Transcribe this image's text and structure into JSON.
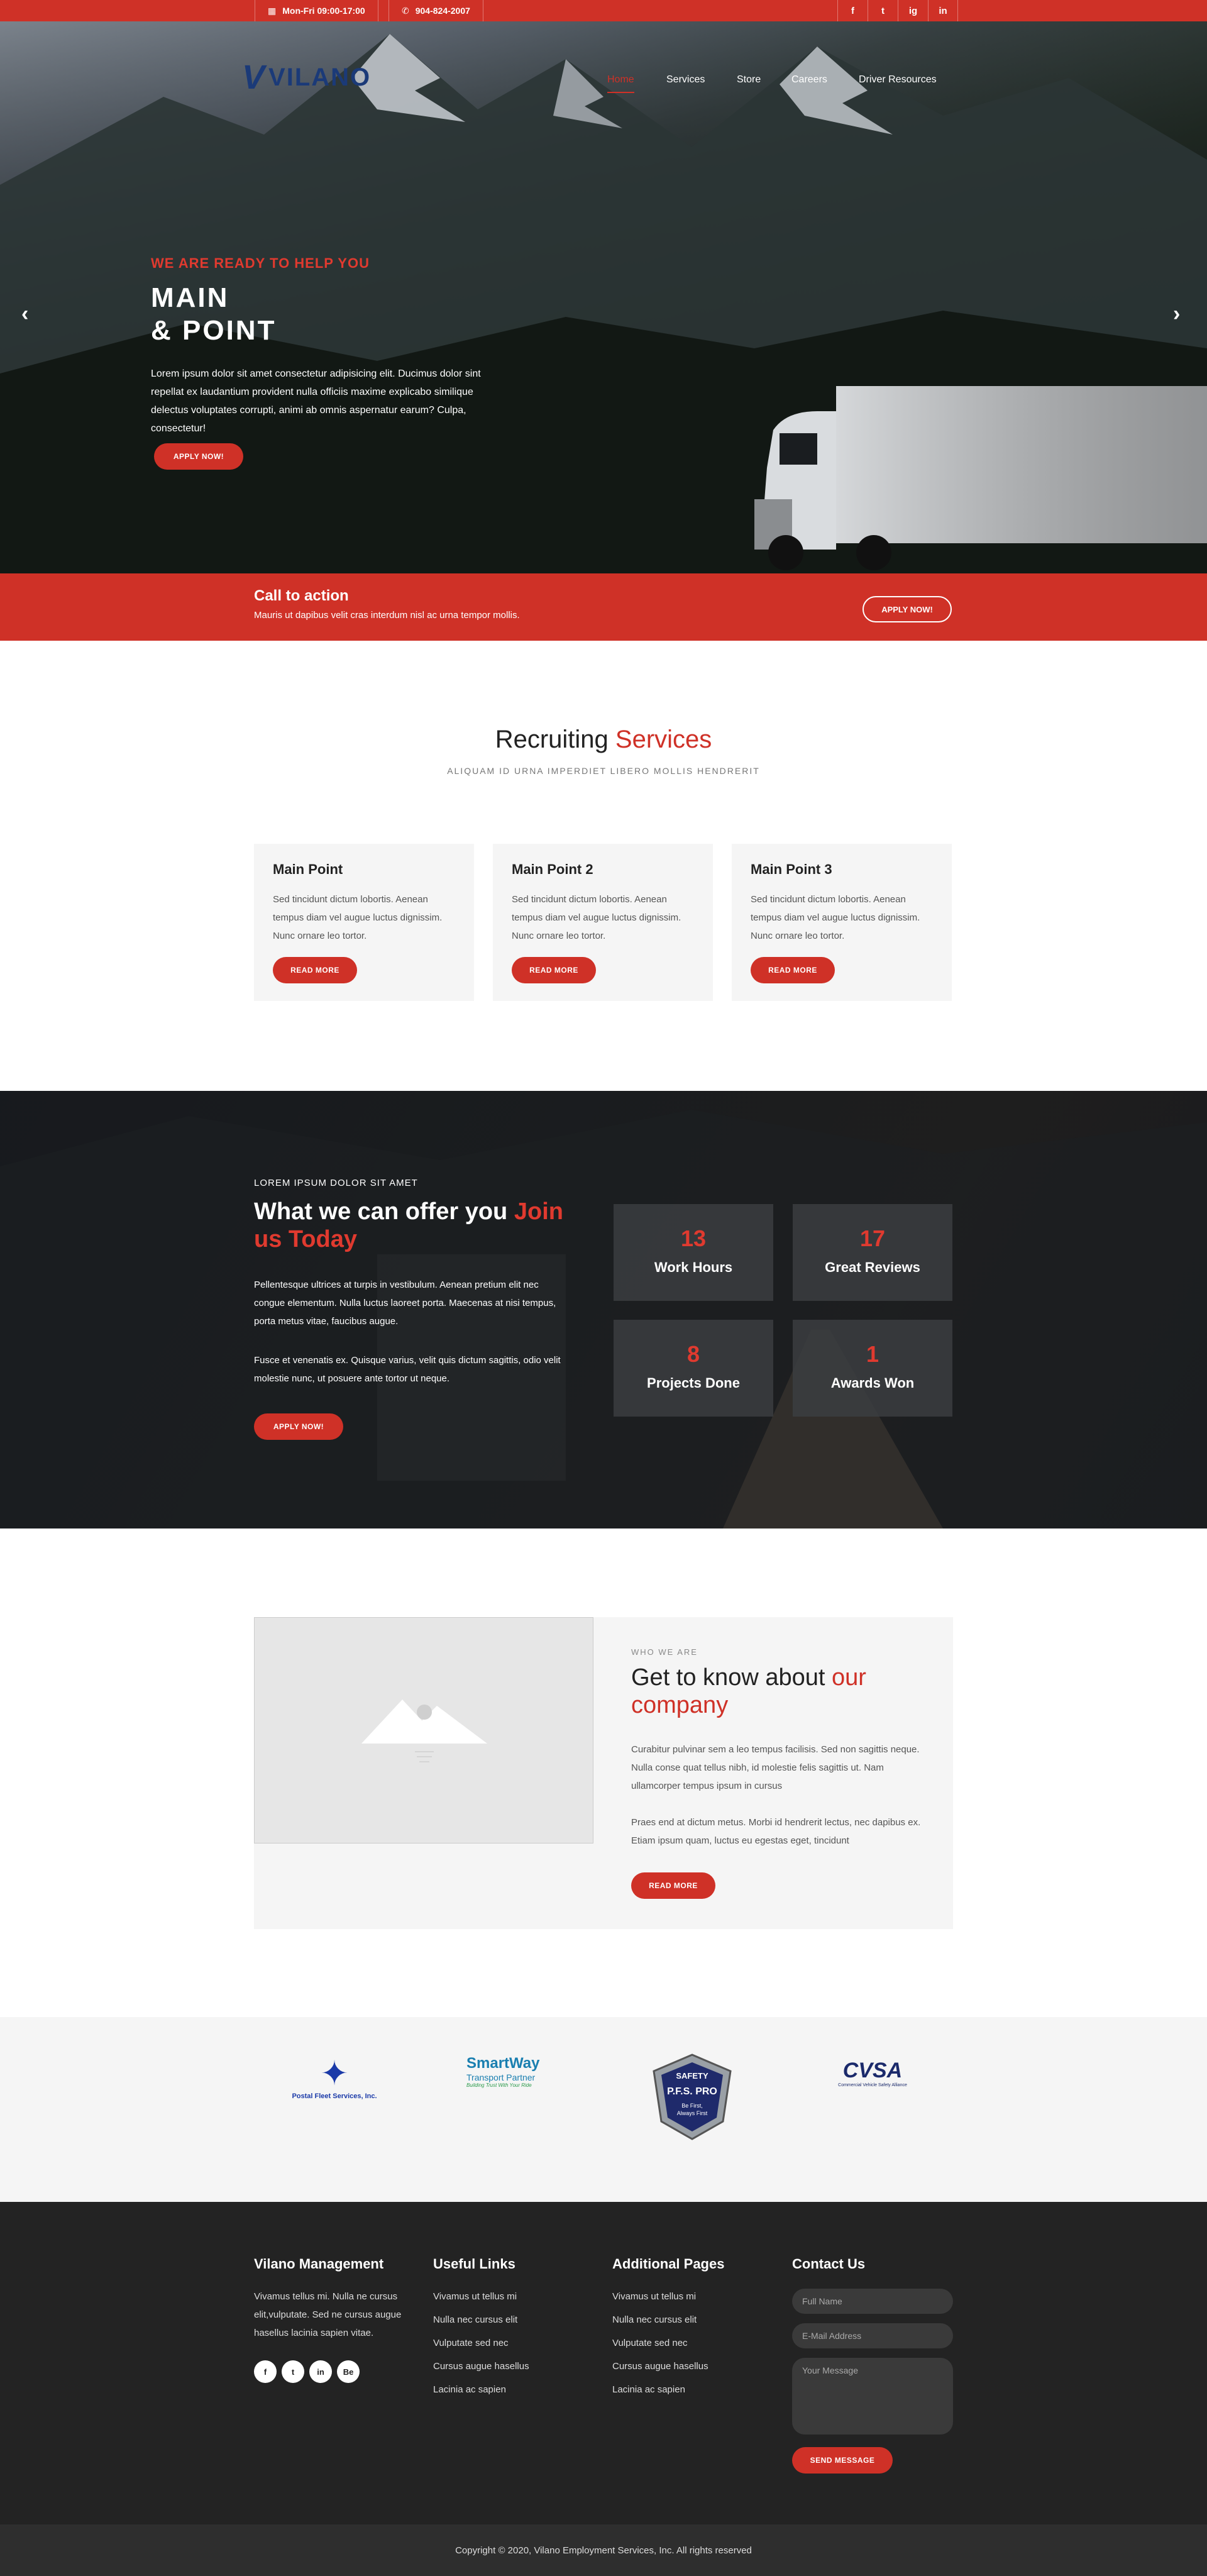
{
  "topbar": {
    "hours": "Mon-Fri 09:00-17:00",
    "phone": "904-824-2007",
    "social": [
      "f",
      "t",
      "ig",
      "in"
    ]
  },
  "header": {
    "logo_text": "VILANO",
    "nav": [
      "Home",
      "Services",
      "Store",
      "Careers",
      "Driver Resources"
    ],
    "active": "Home"
  },
  "hero": {
    "eyebrow": "WE ARE READY TO HELP YOU",
    "title_line1": "MAIN",
    "title_line2": "& POINT",
    "description": "Lorem ipsum dolor sit amet consectetur adipisicing elit. Ducimus dolor sint repellat ex laudantium provident nulla officiis maxime explicabo similique delectus voluptates corrupti, animi ab omnis aspernatur earum? Culpa, consectetur!",
    "button": "APPLY NOW!"
  },
  "cta": {
    "title": "Call to action",
    "text": "Mauris ut dapibus velit cras interdum nisl ac urna tempor mollis.",
    "button": "APPLY NOW!"
  },
  "services": {
    "title_plain": "Recruiting",
    "title_red": "Services",
    "subtitle": "ALIQUAM ID URNA IMPERDIET LIBERO MOLLIS HENDRERIT",
    "cards": [
      {
        "title": "Main Point",
        "text": "Sed tincidunt dictum lobortis. Aenean tempus diam vel augue luctus dignissim. Nunc ornare leo tortor.",
        "button": "READ MORE"
      },
      {
        "title": "Main Point 2",
        "text": "Sed tincidunt dictum lobortis. Aenean tempus diam vel augue luctus dignissim. Nunc ornare leo tortor.",
        "button": "READ MORE"
      },
      {
        "title": "Main Point 3",
        "text": "Sed tincidunt dictum lobortis. Aenean tempus diam vel augue luctus dignissim. Nunc ornare leo tortor.",
        "button": "READ MORE"
      }
    ]
  },
  "offer": {
    "eyebrow": "LOREM IPSUM DOLOR SIT AMET",
    "title_plain": "What we can offer you",
    "title_red": "Join us Today",
    "p1": "Pellentesque ultrices at turpis in vestibulum. Aenean pretium elit nec congue elementum. Nulla luctus laoreet porta. Maecenas at nisi tempus, porta metus vitae, faucibus augue.",
    "p2": "Fusce et venenatis ex. Quisque varius, velit quis dictum sagittis, odio velit molestie nunc, ut posuere ante tortor ut neque.",
    "button": "APPLY NOW!",
    "stats": [
      {
        "num": "13",
        "label": "Work Hours"
      },
      {
        "num": "17",
        "label": "Great Reviews"
      },
      {
        "num": "8",
        "label": "Projects Done"
      },
      {
        "num": "1",
        "label": "Awards Won"
      }
    ]
  },
  "about": {
    "eyebrow": "WHO WE ARE",
    "title_plain": "Get to know about",
    "title_red": "our company",
    "p1": "Curabitur pulvinar sem a leo tempus facilisis. Sed non sagittis neque. Nulla conse quat tellus nibh, id molestie felis sagittis ut. Nam ullamcorper tempus ipsum in cursus",
    "p2": "Praes end at dictum metus. Morbi id hendrerit lectus, nec dapibus ex. Etiam ipsum quam, luctus eu egestas eget, tincidunt",
    "button": "READ MORE"
  },
  "partners": {
    "postal": "Postal Fleet Services, Inc.",
    "smartway_1": "SmartWay",
    "smartway_2": "Transport Partner",
    "smartway_3": "Building Trust With Your Ride",
    "safety_top": "SAFETY",
    "safety_mid": "P.F.S. PRO",
    "safety_bot1": "Be First,",
    "safety_bot2": "Always First",
    "cvsa_text": "CVSA",
    "cvsa_sub": "Commercial Vehicle Safety Alliance"
  },
  "footer": {
    "col1_title": "Vilano Management",
    "col1_text": "Vivamus tellus mi. Nulla ne cursus elit,vulputate. Sed ne cursus augue hasellus lacinia sapien vitae.",
    "social": [
      "f",
      "t",
      "in",
      "Be"
    ],
    "col2_title": "Useful Links",
    "col2_links": [
      "Vivamus ut tellus mi",
      "Nulla nec cursus elit",
      "Vulputate sed nec",
      "Cursus augue hasellus",
      "Lacinia ac sapien"
    ],
    "col3_title": "Additional Pages",
    "col3_links": [
      "Vivamus ut tellus mi",
      "Nulla nec cursus elit",
      "Vulputate sed nec",
      "Cursus augue hasellus",
      "Lacinia ac sapien"
    ],
    "col4_title": "Contact Us",
    "name_placeholder": "Full Name",
    "email_placeholder": "E-Mail Address",
    "message_placeholder": "Your Message",
    "send_button": "SEND MESSAGE"
  },
  "copyright": "Copyright © 2020, Vilano Employment Services, Inc. All rights reserved"
}
